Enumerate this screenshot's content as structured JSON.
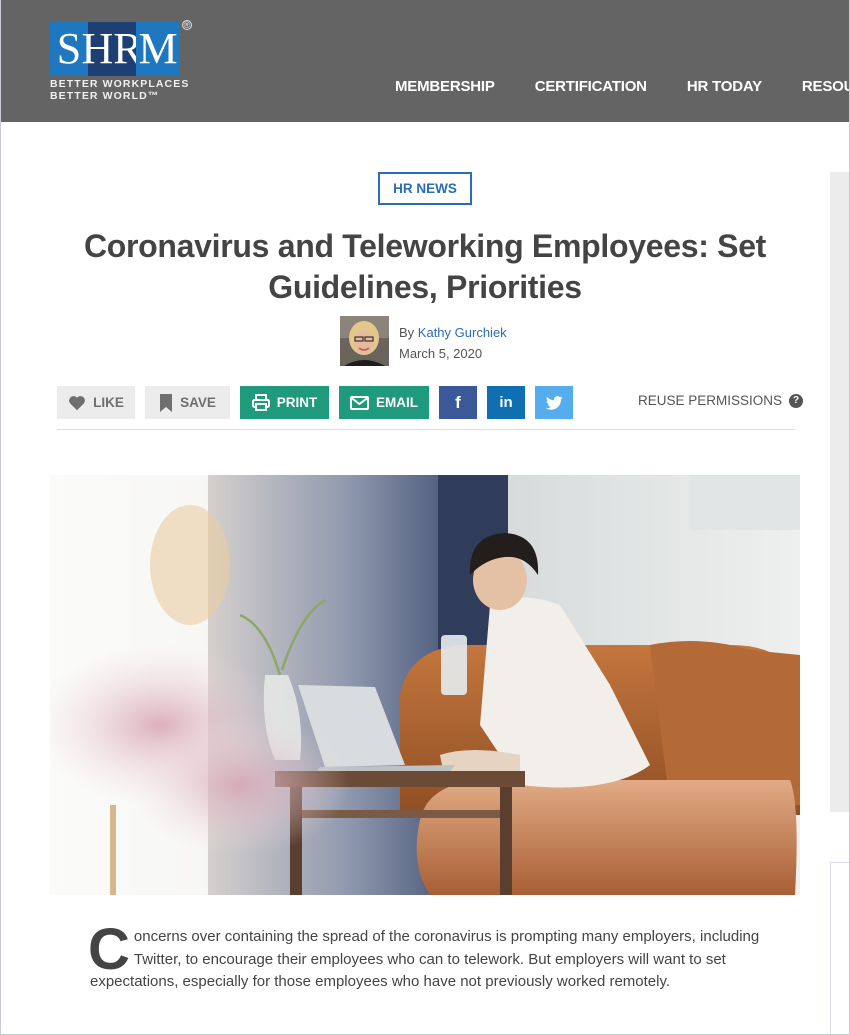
{
  "header": {
    "logo": {
      "letters": [
        "S",
        "HR",
        "M"
      ],
      "registered_mark": "®",
      "tagline_line1": "BETTER WORKPLACES",
      "tagline_line2": "BETTER WORLD™"
    },
    "nav": [
      {
        "label": "MEMBERSHIP"
      },
      {
        "label": "CERTIFICATION"
      },
      {
        "label": "HR TODAY"
      },
      {
        "label": "RESOURCES & TOOLS"
      }
    ]
  },
  "article": {
    "category": "HR NEWS",
    "title": "Coronavirus and Teleworking Employees: Set Guidelines, Priorities",
    "byline_prefix": "By",
    "author": "Kathy Gurchiek",
    "date": "March 5, 2020",
    "actions": {
      "like": "LIKE",
      "save": "SAVE",
      "print": "PRINT",
      "email": "EMAIL",
      "facebook": "f",
      "linkedin": "in",
      "reuse": "REUSE PERMISSIONS",
      "help": "?"
    },
    "hero_alt": "Woman drinking water while working on laptop from a leather couch at home",
    "lead_dropcap": "C",
    "lead_text": "oncerns over containing the spread of the coronavirus is prompting many employers, including Twitter, to encourage their employees who can to telework. But employers will want to set expectations, especially for those employees who have not previously worked remotely."
  },
  "colors": {
    "header_bg": "#646464",
    "brand_blue": "#1f78bf",
    "brand_navy": "#1d3f73",
    "link_blue": "#2a6db5",
    "action_green": "#1f9a7d",
    "facebook": "#3b5998",
    "linkedin": "#0f6fb1",
    "twitter": "#55acee"
  }
}
